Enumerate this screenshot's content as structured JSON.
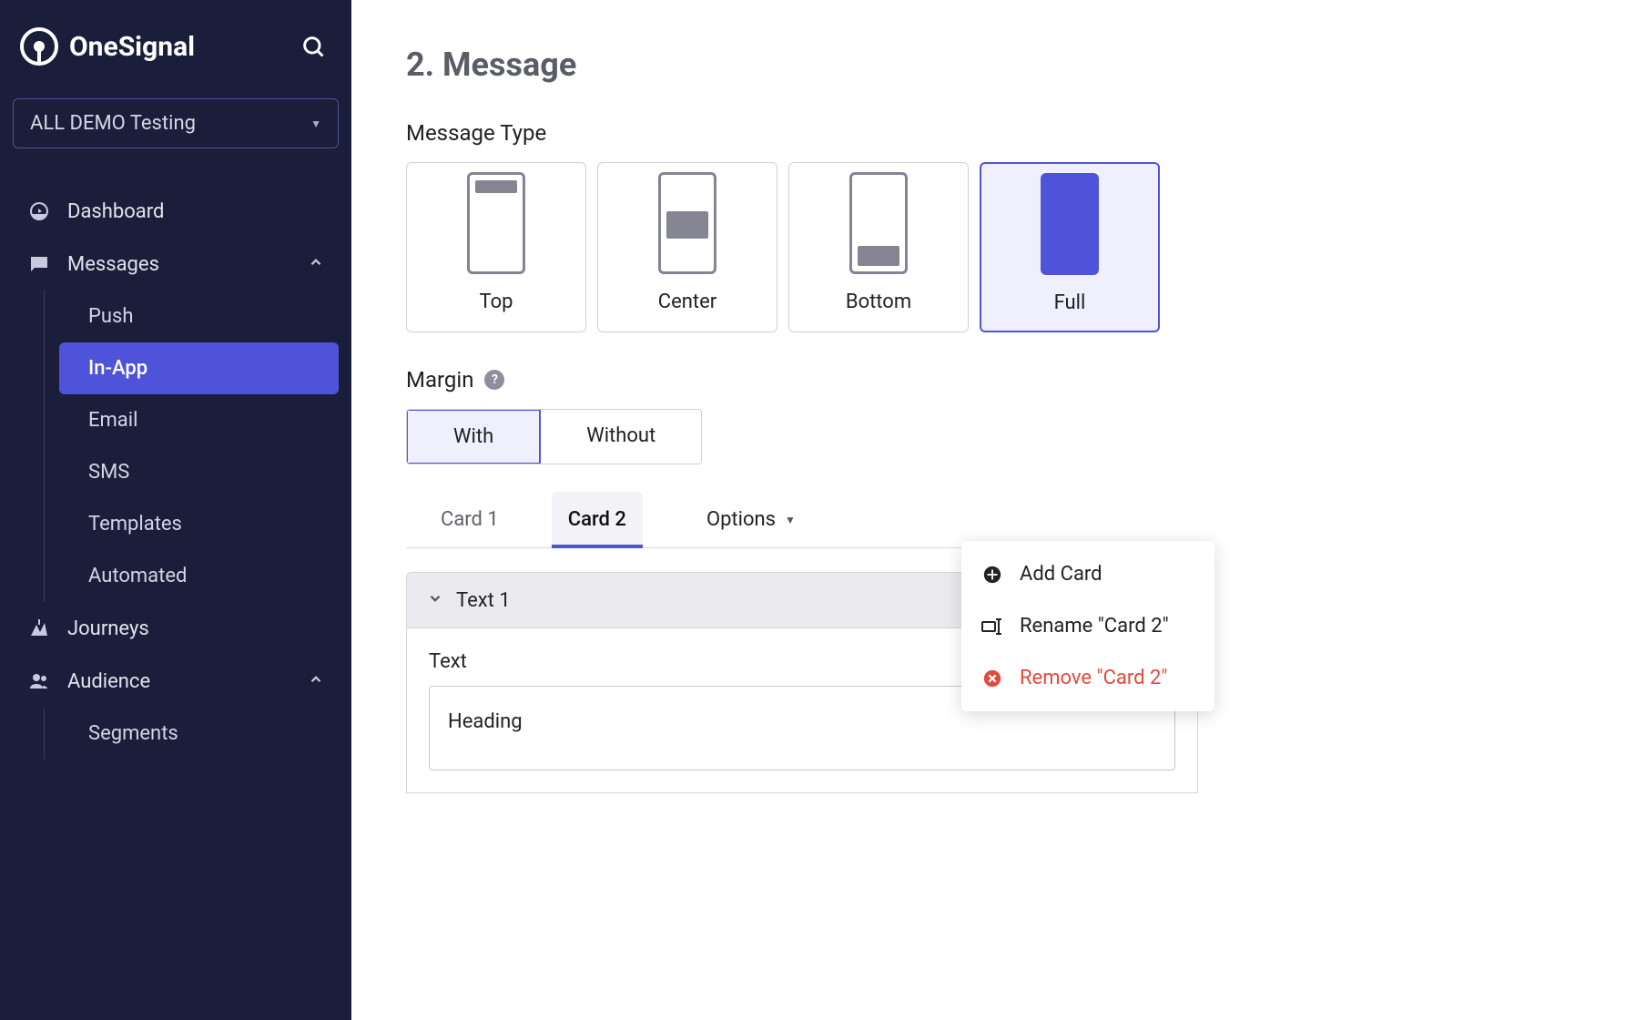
{
  "brand": "OneSignal",
  "app_switcher": "ALL DEMO Testing",
  "nav": {
    "dashboard": "Dashboard",
    "messages": "Messages",
    "journeys": "Journeys",
    "audience": "Audience"
  },
  "messages_sub": {
    "push": "Push",
    "inapp": "In-App",
    "email": "Email",
    "sms": "SMS",
    "templates": "Templates",
    "automated": "Automated"
  },
  "audience_sub": {
    "segments": "Segments"
  },
  "section": {
    "title": "2. Message",
    "message_type_label": "Message Type",
    "margin_label": "Margin"
  },
  "message_types": {
    "top": "Top",
    "center": "Center",
    "bottom": "Bottom",
    "full": "Full"
  },
  "margin": {
    "with": "With",
    "without": "Without"
  },
  "tabs": {
    "card1": "Card 1",
    "card2": "Card 2",
    "options": "Options"
  },
  "block": {
    "text1": "Text 1",
    "text_label": "Text",
    "heading_value": "Heading"
  },
  "dropdown": {
    "add": "Add Card",
    "rename": "Rename \"Card 2\"",
    "remove": "Remove \"Card 2\""
  }
}
